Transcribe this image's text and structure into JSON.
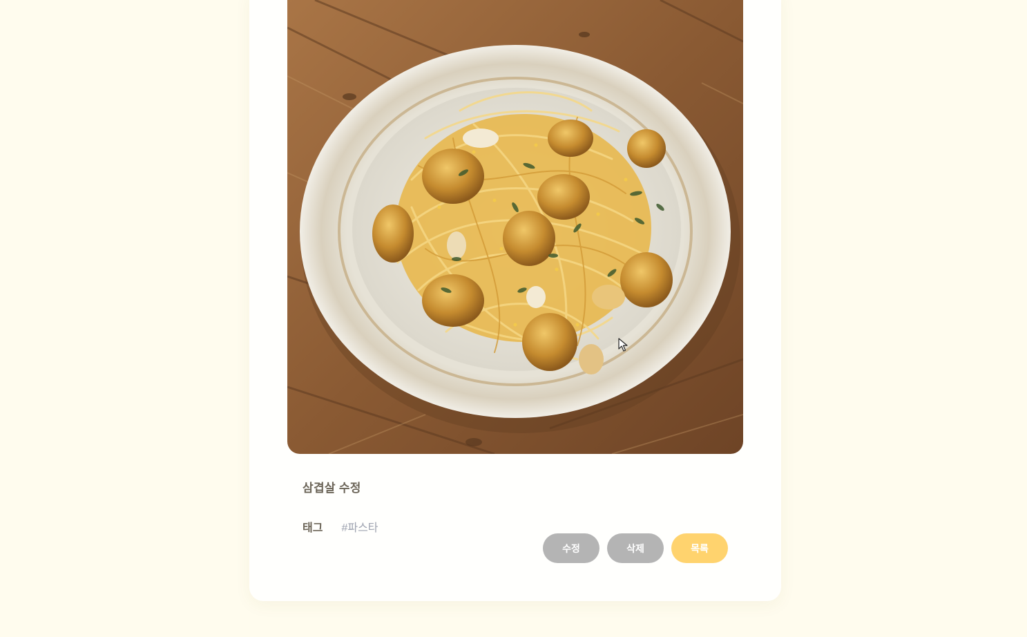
{
  "post": {
    "title": "삼겹살 수정",
    "photo_alt": "garlic scallop pasta",
    "tag_label": "태그",
    "tags": [
      "#파스타"
    ]
  },
  "actions": {
    "edit_label": "수정",
    "delete_label": "삭제",
    "list_label": "목록"
  },
  "colors": {
    "page_background": "#fffcee",
    "button_gray": "#b4b4b4",
    "button_accent": "#ffd36e",
    "tag_text": "#9ea3b0",
    "title_text": "#6b6457"
  },
  "icons": {
    "cursor": "mouse-pointer-icon"
  }
}
